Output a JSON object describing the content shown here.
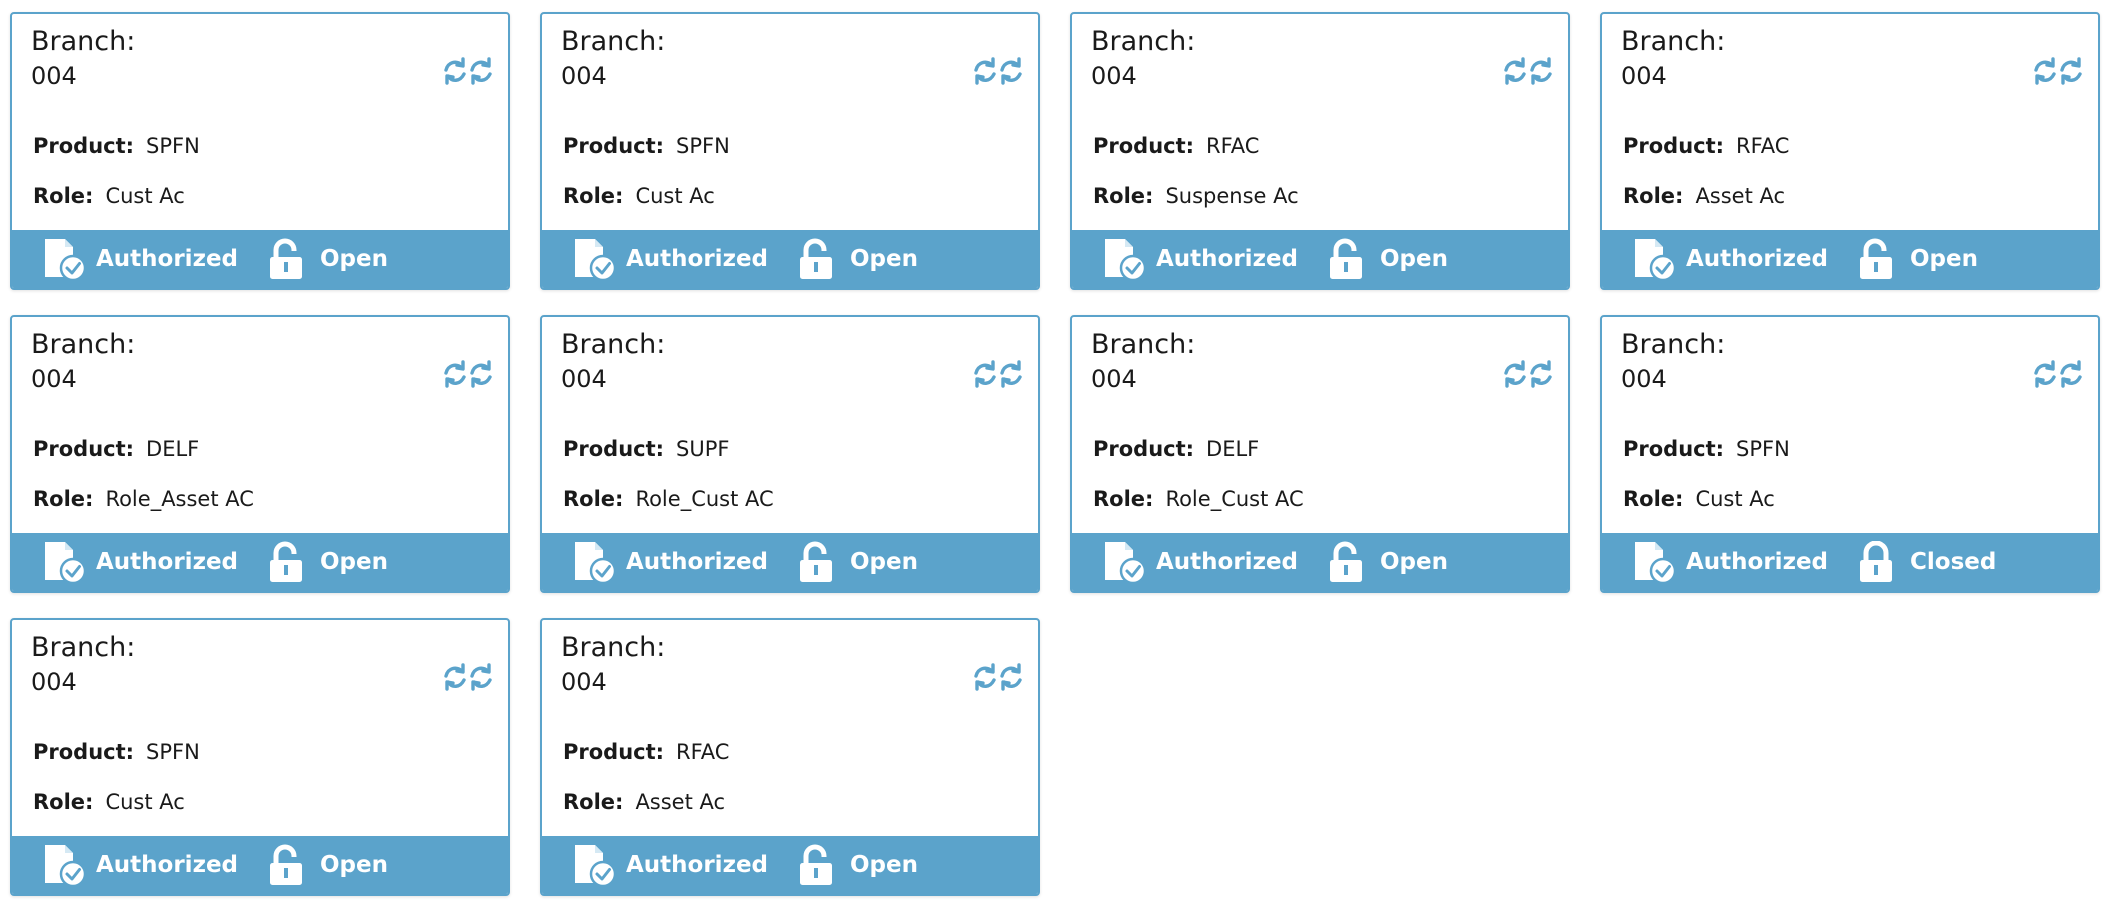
{
  "labels": {
    "branch": "Branch:",
    "product": "Product:",
    "role": "Role:"
  },
  "colors": {
    "accent": "#5ba3cb",
    "card_background": "#ffffff",
    "text": "#1a1a1a",
    "footer_text": "#ffffff"
  },
  "icons": {
    "refresh": "sync-arrows-icon",
    "authorization": "document-check-icon",
    "lock_open": "lock-open-icon",
    "lock_closed": "lock-closed-icon"
  },
  "cards": [
    {
      "branch": "004",
      "product": "SPFN",
      "role": "Cust Ac",
      "auth_status": "Authorized",
      "lock_status": "Open"
    },
    {
      "branch": "004",
      "product": "SPFN",
      "role": "Cust Ac",
      "auth_status": "Authorized",
      "lock_status": "Open"
    },
    {
      "branch": "004",
      "product": "RFAC",
      "role": "Suspense Ac",
      "auth_status": "Authorized",
      "lock_status": "Open"
    },
    {
      "branch": "004",
      "product": "RFAC",
      "role": "Asset Ac",
      "auth_status": "Authorized",
      "lock_status": "Open"
    },
    {
      "branch": "004",
      "product": "DELF",
      "role": "Role_Asset AC",
      "auth_status": "Authorized",
      "lock_status": "Open"
    },
    {
      "branch": "004",
      "product": "SUPF",
      "role": "Role_Cust AC",
      "auth_status": "Authorized",
      "lock_status": "Open"
    },
    {
      "branch": "004",
      "product": "DELF",
      "role": "Role_Cust AC",
      "auth_status": "Authorized",
      "lock_status": "Open"
    },
    {
      "branch": "004",
      "product": "SPFN",
      "role": "Cust Ac",
      "auth_status": "Authorized",
      "lock_status": "Closed"
    },
    {
      "branch": "004",
      "product": "SPFN",
      "role": "Cust Ac",
      "auth_status": "Authorized",
      "lock_status": "Open"
    },
    {
      "branch": "004",
      "product": "RFAC",
      "role": "Asset Ac",
      "auth_status": "Authorized",
      "lock_status": "Open"
    }
  ]
}
